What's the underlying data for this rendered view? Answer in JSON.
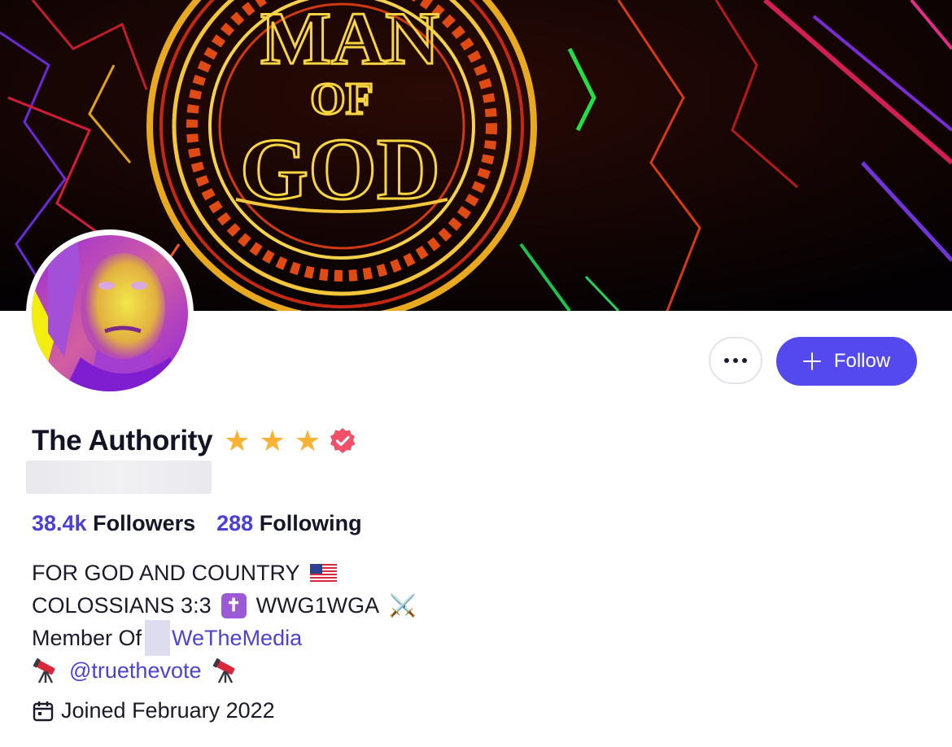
{
  "banner": {
    "text_line1": "MAN",
    "text_line2": "OF",
    "text_line3": "GOD"
  },
  "profile": {
    "name": "The Authority",
    "stars": [
      "★",
      "★",
      "★"
    ],
    "followers_count": "38.4k",
    "followers_label": "Followers",
    "following_count": "288",
    "following_label": "Following",
    "bio": {
      "line1": "FOR GOD AND COUNTRY",
      "line2_a": "COLOSSIANS 3:3",
      "line2_cross": "✝",
      "line2_b": "WWG1WGA",
      "line2_emoji": "⚔️",
      "line3_prefix": "Member Of",
      "line3_link": "WeTheMedia",
      "line4_link": "@truethevote"
    },
    "joined": "Joined February 2022"
  },
  "actions": {
    "follow_label": "Follow"
  },
  "colors": {
    "accent": "#5449ef",
    "link": "#4d43cf",
    "star": "#f9b233",
    "verified": "#f24f68"
  },
  "icons": [
    "more-icon",
    "plus-icon",
    "star-icon",
    "verified-badge-icon",
    "us-flag-icon",
    "cross-icon",
    "crossed-swords-icon",
    "telescope-icon",
    "calendar-icon"
  ]
}
